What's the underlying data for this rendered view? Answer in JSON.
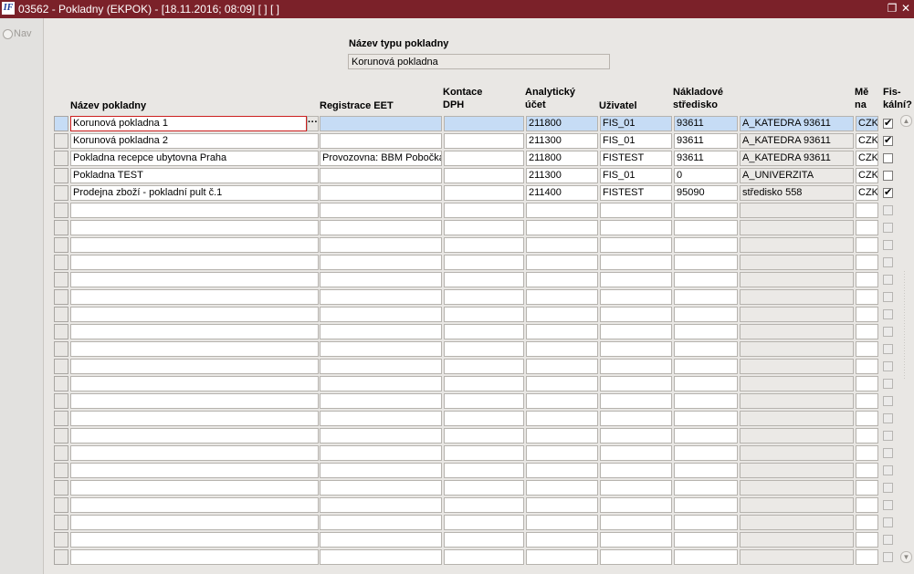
{
  "window": {
    "title": "03562 - Pokladny (EKPOK) - [18.11.2016; 08:09] [ ] [ ]",
    "restore_glyph": "❐",
    "close_glyph": "✕",
    "app_icon_text": "IF"
  },
  "leftpane": {
    "nav_label": "Nav"
  },
  "type_header": {
    "label": "Název typu pokladny",
    "value": "Korunová pokladna"
  },
  "columns": {
    "nazev": "Název pokladny",
    "eet": "Registrace EET",
    "kontace1": "Kontace",
    "kontace2": "DPH",
    "ucet1": "Analytický",
    "ucet2": "účet",
    "uzivatel": "Uživatel",
    "stredisko1": "Nákladové",
    "stredisko2": "středisko",
    "mena1": "Mě",
    "mena2": "na",
    "fiskalni1": "Fis-",
    "fiskalni2": "kální?"
  },
  "row_ellipsis": "···",
  "rows": [
    {
      "nazev": "Korunová pokladna 1",
      "eet": "",
      "kontace": "",
      "ucet": "211800",
      "uzivatel": "FIS_01",
      "stredisko": "93611",
      "stredisko_nazev": "A_KATEDRA 93611",
      "mena": "CZK",
      "fiskalni": "✔"
    },
    {
      "nazev": "Korunová pokladna 2",
      "eet": "",
      "kontace": "",
      "ucet": "211300",
      "uzivatel": "FIS_01",
      "stredisko": "93611",
      "stredisko_nazev": "A_KATEDRA 93611",
      "mena": "CZK",
      "fiskalni": "✔"
    },
    {
      "nazev": "Pokladna recepce ubytovna Praha",
      "eet": "Provozovna: BBM Pobočka",
      "kontace": "",
      "ucet": "211800",
      "uzivatel": "FISTEST",
      "stredisko": "93611",
      "stredisko_nazev": "A_KATEDRA 93611",
      "mena": "CZK",
      "fiskalni": ""
    },
    {
      "nazev": "Pokladna TEST",
      "eet": "",
      "kontace": "",
      "ucet": "211300",
      "uzivatel": "FIS_01",
      "stredisko": "0",
      "stredisko_nazev": "A_UNIVERZITA",
      "mena": "CZK",
      "fiskalni": ""
    },
    {
      "nazev": "Prodejna zboží - pokladní pult č.1",
      "eet": "",
      "kontace": "",
      "ucet": "211400",
      "uzivatel": "FISTEST",
      "stredisko": "95090",
      "stredisko_nazev": "středisko 558",
      "mena": "CZK",
      "fiskalni": "✔"
    }
  ],
  "empty_row_count": 21,
  "scrollbar": {
    "up": "▲",
    "down": "▼"
  }
}
